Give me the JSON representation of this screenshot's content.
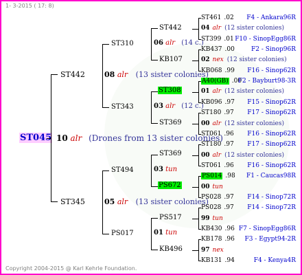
{
  "header": "1-  3-2015  ( 17:  8)",
  "footer": "Copyright 2004-2015 @ Karl Kehrle Foundation.",
  "root": {
    "name": "ST045",
    "gen": "10",
    "alr": "alr",
    "note": "(Drones from 13 sister colonies)"
  },
  "gen2": [
    {
      "name": "ST442",
      "gen": "08",
      "tag": "alr",
      "note": "(13 sister colonies)"
    },
    {
      "name": "ST345",
      "gen": "05",
      "tag": "alr",
      "note": "(13 sister colonies)"
    }
  ],
  "gen3": [
    {
      "name": "ST310",
      "gen": "06",
      "tag": "alr",
      "note": "(14 c.)"
    },
    {
      "name": "ST343",
      "gen": "03",
      "tag": "alr",
      "note": "(12 c.)"
    },
    {
      "name": "ST494",
      "gen": "03",
      "tag": "tun",
      "note": ""
    },
    {
      "name": "PS017",
      "gen": "01",
      "tag": "tun",
      "note": ""
    }
  ],
  "gen4": [
    "ST442",
    "KB107",
    "ST308",
    "ST369",
    "ST369",
    "PS672",
    "PS517",
    "KB496"
  ],
  "gen5": [
    {
      "id": "ST461",
      "val": ".02",
      "ped": "F4 - Ankara96R"
    },
    {
      "id": "04",
      "tag": "alr",
      "note": "(12 sister colonies)"
    },
    {
      "id": "ST399",
      "val": ".01",
      "ped": "F10 - SinopEgg86R"
    },
    {
      "id": "KB437",
      "val": ".00",
      "ped": "F2 - Sinop96R"
    },
    {
      "id": "02",
      "tag": "nex",
      "note": "(12 sister colonies)"
    },
    {
      "id": "KB068",
      "val": ".99",
      "ped": "F16 - Sinop62R"
    },
    {
      "id": "A40(GB)",
      "val": ".00",
      "ped": "F2 - Bayburt98-3R"
    },
    {
      "id": "01",
      "tag": "alr",
      "note": "(12 sister colonies)"
    },
    {
      "id": "KB096",
      "val": ".97",
      "ped": "F15 - Sinop62R"
    },
    {
      "id": "ST180",
      "val": ".97",
      "ped": "F17 - Sinop62R"
    },
    {
      "id": "00",
      "tag": "alr",
      "note": "(12 sister colonies)"
    },
    {
      "id": "ST061",
      "val": ".96",
      "ped": "F16 - Sinop62R"
    },
    {
      "id": "ST180",
      "val": ".97",
      "ped": "F17 - Sinop62R"
    },
    {
      "id": "00",
      "tag": "alr",
      "note": "(12 sister colonies)"
    },
    {
      "id": "ST061",
      "val": ".96",
      "ped": "F16 - Sinop62R"
    },
    {
      "id": "PS014",
      "val": ".98",
      "ped": "F1 - Caucas98R"
    },
    {
      "id": "00",
      "tag": "tun",
      "note": ""
    },
    {
      "id": "PS028",
      "val": ".97",
      "ped": "F14 - Sinop72R"
    },
    {
      "id": "PS028",
      "val": ".97",
      "ped": "F14 - Sinop72R"
    },
    {
      "id": "99",
      "tag": "tun",
      "note": ""
    },
    {
      "id": "KB430",
      "val": ".96",
      "ped": "F7 - SinopEgg86R"
    },
    {
      "id": "KB178",
      "val": ".96",
      "ped": "F3 - Egypt94-2R"
    },
    {
      "id": "97",
      "tag": "nex",
      "note": ""
    },
    {
      "id": "KB131",
      "val": ".94",
      "ped": "F4 - Kenya4R"
    }
  ],
  "colors": {
    "border": "#ff00cc",
    "tag": "#cc0000",
    "note": "#333399",
    "pedigree": "#0000cc",
    "highlight": "#00ee00",
    "root_bg": "#ffccff"
  }
}
